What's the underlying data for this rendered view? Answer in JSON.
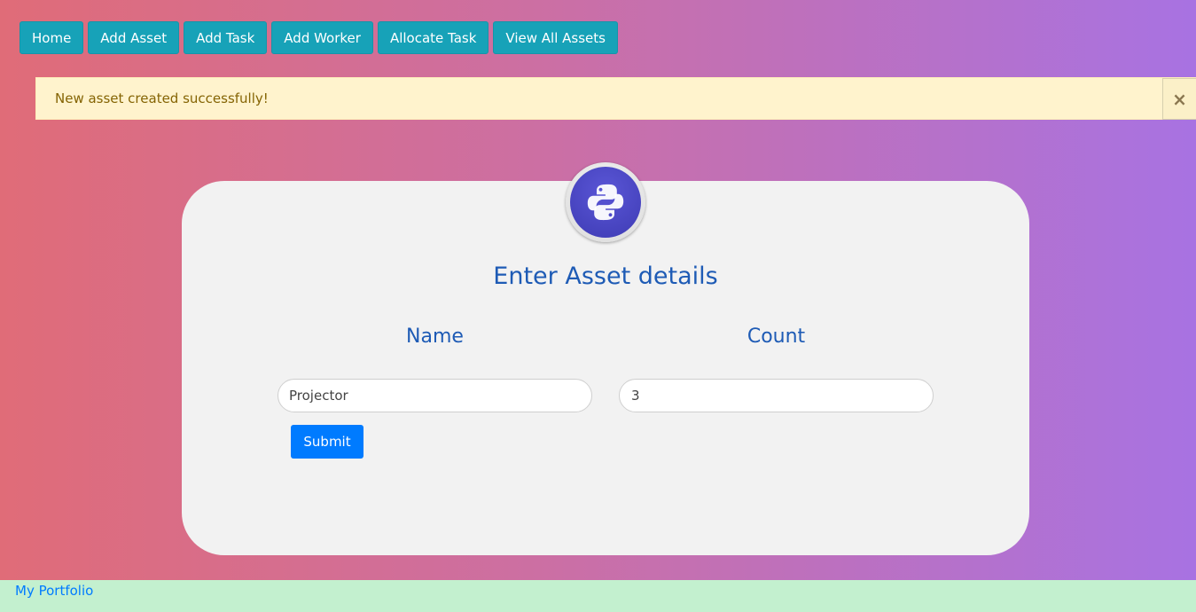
{
  "nav": {
    "items": [
      {
        "label": "Home"
      },
      {
        "label": "Add Asset"
      },
      {
        "label": "Add Task"
      },
      {
        "label": "Add Worker"
      },
      {
        "label": "Allocate Task"
      },
      {
        "label": "View All Assets"
      }
    ]
  },
  "alert": {
    "message": "New asset created successfully!",
    "close_symbol": "×"
  },
  "form": {
    "title": "Enter Asset details",
    "name_label": "Name",
    "count_label": "Count",
    "name_value": "Projector",
    "count_value": "3",
    "submit_label": "Submit"
  },
  "footer": {
    "link_label": "My Portfolio"
  },
  "colors": {
    "nav_button": "#17a2b8",
    "alert_bg": "#fff3cd",
    "alert_text": "#856404",
    "title_text": "#1e5bb5",
    "submit_button": "#007bff",
    "footer_bg": "#c3f0cf",
    "footer_link": "#007bff"
  },
  "icons": {
    "logo": "python-logo-icon",
    "close": "close-icon"
  }
}
